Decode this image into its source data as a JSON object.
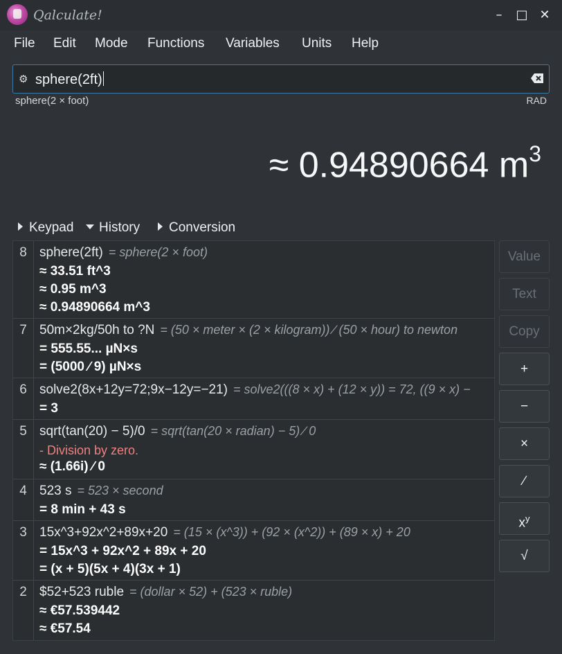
{
  "window": {
    "title": "Qalculate!",
    "minimize": "–",
    "maximize": "□",
    "close": "✕"
  },
  "menu": [
    "File",
    "Edit",
    "Mode",
    "Functions",
    "Variables",
    "Units",
    "Help"
  ],
  "expression": {
    "value": "sphere(2ft)",
    "parsed": "sphere(2 × foot)",
    "angle_mode": "RAD"
  },
  "result": {
    "prefix": "≈ 0.94890664 m",
    "exponent": "3"
  },
  "toggles": {
    "keypad": "Keypad",
    "history": "History",
    "conversion": "Conversion"
  },
  "history": [
    {
      "num": "8",
      "expr": "sphere(2ft)",
      "parsed": "= sphere(2 × foot)",
      "results": [
        "≈ 33.51 ft^3",
        "≈ 0.95 m^3",
        "≈ 0.94890664 m^3"
      ],
      "error": ""
    },
    {
      "num": "7",
      "expr": "50m×2kg/50h to ?N",
      "parsed": "= (50 × meter × (2 × kilogram)) ∕ (50 × hour) to newton",
      "results": [
        "= 555.55... µN×s",
        "= (5000 ∕ 9) µN×s"
      ],
      "error": ""
    },
    {
      "num": "6",
      "expr": "solve2(8x+12y=72;9x−12y=−21)",
      "parsed": "= solve2(((8 × x) + (12 × y)) = 72, ((9 × x) −",
      "results": [
        "= 3"
      ],
      "error": ""
    },
    {
      "num": "5",
      "expr": "sqrt(tan(20) − 5)/0",
      "parsed": "= sqrt(tan(20 × radian) − 5) ∕ 0",
      "results": [
        "≈ (1.66i) ∕ 0"
      ],
      "error": "- Division by zero."
    },
    {
      "num": "4",
      "expr": "523 s",
      "parsed": "= 523 × second",
      "results": [
        "= 8 min + 43 s"
      ],
      "error": ""
    },
    {
      "num": "3",
      "expr": "15x^3+92x^2+89x+20",
      "parsed": "= (15 × (x^3)) + (92 × (x^2)) + (89 × x) + 20",
      "results": [
        "= 15x^3 + 92x^2 + 89x + 20",
        "= (x + 5)(5x + 4)(3x + 1)"
      ],
      "error": ""
    },
    {
      "num": "2",
      "expr": "$52+523 ruble",
      "parsed": "= (dollar × 52) + (523 × ruble)",
      "results": [
        "≈ €57.539442",
        "≈ €57.54"
      ],
      "error": ""
    }
  ],
  "side_buttons": {
    "value": "Value",
    "text": "Text",
    "copy": "Copy",
    "add": "+",
    "subtract": "−",
    "multiply": "×",
    "divide": "∕",
    "power_base": "x",
    "power_exp": "y",
    "sqrt": "√"
  }
}
